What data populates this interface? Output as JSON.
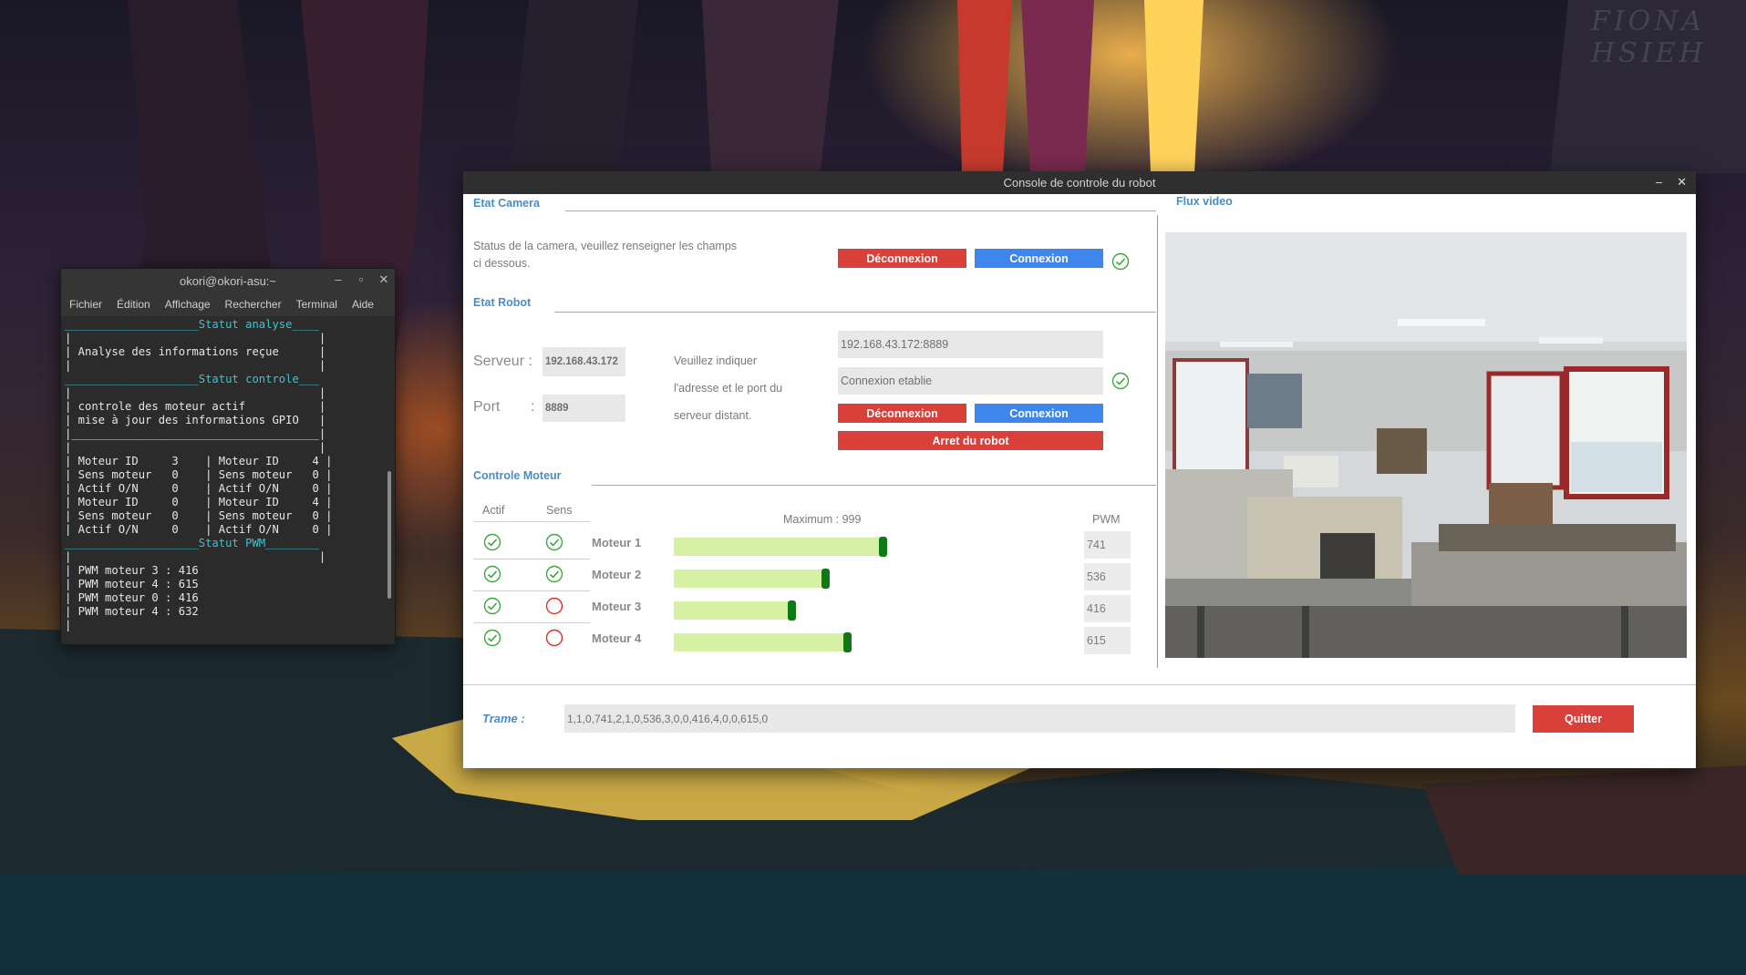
{
  "desktop": {
    "signature": "FIONA HSIEH"
  },
  "terminal": {
    "title": "okori@okori-asu:~",
    "controls": [
      "–",
      "▫",
      "✕"
    ],
    "menu": [
      "Fichier",
      "Édition",
      "Affichage",
      "Rechercher",
      "Terminal",
      "Aide"
    ],
    "lines": [
      {
        "cy": true,
        "text": "____________________Statut analyse____"
      },
      {
        "cy": false,
        "text": "|                                     |"
      },
      {
        "cy": false,
        "text": "| Analyse des informations reçue      |"
      },
      {
        "cy": false,
        "text": "|                                     |"
      },
      {
        "cy": true,
        "text": "____________________Statut controle___"
      },
      {
        "cy": false,
        "text": "|                                     |"
      },
      {
        "cy": false,
        "text": "| controle des moteur actif           |"
      },
      {
        "cy": false,
        "text": "| mise à jour des informations GPIO   |"
      },
      {
        "cy": false,
        "text": "|_____________________________________|"
      },
      {
        "cy": false,
        "text": "|                                     |"
      },
      {
        "cy": false,
        "text": "| Moteur ID     3    | Moteur ID     4 |"
      },
      {
        "cy": false,
        "text": "| Sens moteur   0    | Sens moteur   0 |"
      },
      {
        "cy": false,
        "text": "| Actif O/N     0    | Actif O/N     0 |"
      },
      {
        "cy": false,
        "text": "| Moteur ID     0    | Moteur ID     4 |"
      },
      {
        "cy": false,
        "text": "| Sens moteur   0    | Sens moteur   0 |"
      },
      {
        "cy": false,
        "text": "| Actif O/N     0    | Actif O/N     0 |"
      },
      {
        "cy": true,
        "text": "____________________Statut PWM________"
      },
      {
        "cy": false,
        "text": "|                                     |"
      },
      {
        "cy": false,
        "text": "| PWM moteur 3 : 416"
      },
      {
        "cy": false,
        "text": "| PWM moteur 4 : 615"
      },
      {
        "cy": false,
        "text": "| PWM moteur 0 : 416"
      },
      {
        "cy": false,
        "text": "| PWM moteur 4 : 632"
      },
      {
        "cy": false,
        "text": "|"
      }
    ]
  },
  "app": {
    "title": "Console de controle du robot",
    "controls": [
      "–",
      "✕"
    ],
    "camera": {
      "section_title": "Etat Camera",
      "status_line1": "Status de la camera, veuillez renseigner les champs",
      "status_line2": "ci dessous.",
      "disconnect": "Déconnexion",
      "connect": "Connexion",
      "status_icon": "check-circle-icon"
    },
    "robot": {
      "section_title": "Etat Robot",
      "server_label": "Serveur :",
      "server_value": "192.168.43.172",
      "port_label": "Port",
      "port_colon": ":",
      "port_value": "8889",
      "hint_line1": "Veuillez indiquer",
      "hint_line2": "l'adresse et le port du",
      "hint_line3": "serveur distant.",
      "address_field": "192.168.43.172:8889",
      "status_field": "Connexion etablie",
      "disconnect": "Déconnexion",
      "connect": "Connexion",
      "stop": "Arret du robot"
    },
    "motors": {
      "section_title": "Controle Moteur",
      "col_actif": "Actif",
      "col_sens": "Sens",
      "maximum": "Maximum : 999",
      "col_pwm": "PWM",
      "max_value": 999,
      "rows": [
        {
          "name": "Moteur 1",
          "actif": true,
          "sens": true,
          "pwm": "741",
          "value": 741
        },
        {
          "name": "Moteur 2",
          "actif": true,
          "sens": true,
          "pwm": "536",
          "value": 536
        },
        {
          "name": "Moteur 3",
          "actif": true,
          "sens": false,
          "pwm": "416",
          "value": 416
        },
        {
          "name": "Moteur 4",
          "actif": true,
          "sens": false,
          "pwm": "615",
          "value": 615
        }
      ]
    },
    "video": {
      "section_title": "Flux video"
    },
    "trame": {
      "label": "Trame :",
      "value": "1,1,0,741,2,1,0,536,3,0,0,416,4,0,0,615,0",
      "quit": "Quitter"
    },
    "colors": {
      "accent": "#4a8cc8",
      "red_button": "#d9403a",
      "blue_button": "#3f86ec",
      "ok_green": "#3aa83a",
      "off_red": "#e0302a",
      "slider_fill": "#d6f1a4",
      "slider_thumb": "#0e7a16"
    }
  }
}
